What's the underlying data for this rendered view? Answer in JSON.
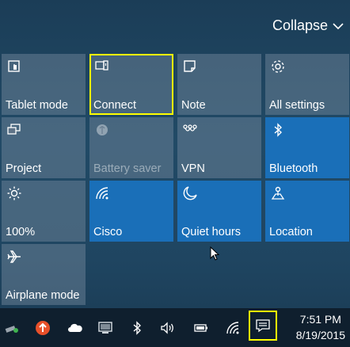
{
  "header": {
    "collapse_label": "Collapse"
  },
  "tiles": [
    {
      "label": "Tablet mode",
      "icon": "tablet-mode-icon",
      "state": "off-normal"
    },
    {
      "label": "Connect",
      "icon": "connect-icon",
      "state": "normal",
      "highlighted": true
    },
    {
      "label": "Note",
      "icon": "note-icon",
      "state": "normal"
    },
    {
      "label": "All settings",
      "icon": "gear-icon",
      "state": "normal"
    },
    {
      "label": "Project",
      "icon": "project-icon",
      "state": "normal"
    },
    {
      "label": "Battery saver",
      "icon": "battery-saver-icon",
      "state": "disabled"
    },
    {
      "label": "VPN",
      "icon": "vpn-icon",
      "state": "normal"
    },
    {
      "label": "Bluetooth",
      "icon": "bluetooth-icon",
      "state": "on"
    },
    {
      "label": "100%",
      "icon": "brightness-icon",
      "state": "normal"
    },
    {
      "label": "Cisco",
      "icon": "wifi-icon",
      "state": "on"
    },
    {
      "label": "Quiet hours",
      "icon": "moon-icon",
      "state": "on"
    },
    {
      "label": "Location",
      "icon": "location-icon",
      "state": "on"
    },
    {
      "label": "Airplane mode",
      "icon": "airplane-icon",
      "state": "normal"
    }
  ],
  "taskbar": {
    "time": "7:51 PM",
    "date": "8/19/2015",
    "tray_icons": [
      "network-usb-icon",
      "update-arrow-icon",
      "onedrive-cloud-icon",
      "monitor-icon",
      "bluetooth-tray-icon",
      "volume-icon",
      "battery-icon",
      "wifi-tray-icon",
      "action-center-icon"
    ]
  },
  "colors": {
    "tile_on": "#1a6fb8",
    "tile_off": "#5f7488",
    "highlight": "#ffff00",
    "taskbar": "#0f1f2e"
  }
}
